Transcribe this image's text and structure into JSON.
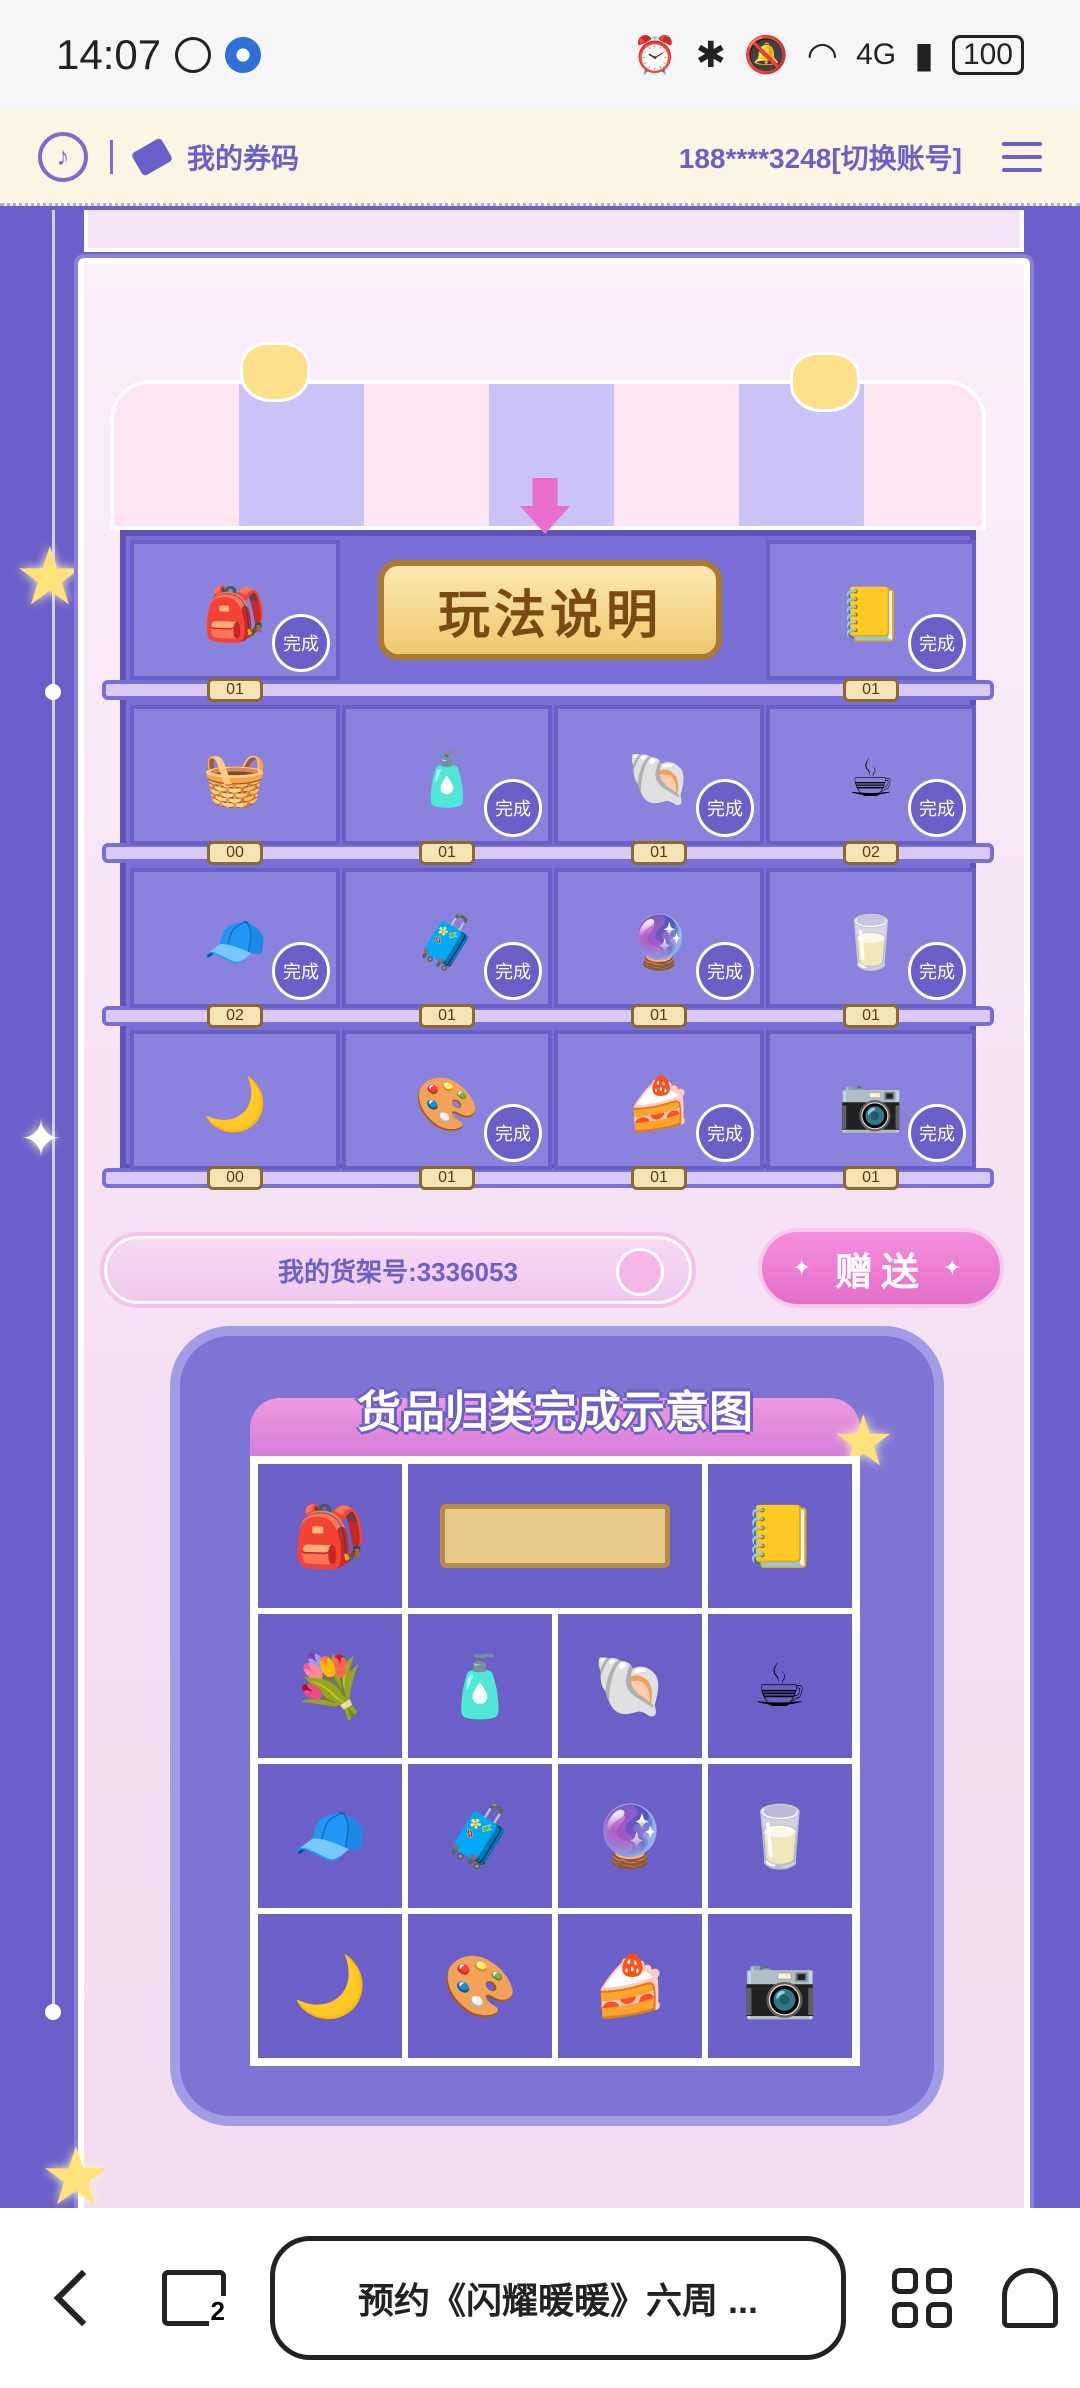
{
  "status_bar": {
    "time": "14:07",
    "network": "4G",
    "battery": "100"
  },
  "site_header": {
    "coupon_label": "我的券码",
    "account_text": "188****3248[切换账号]"
  },
  "shelf": {
    "howto_label": "玩法说明",
    "done_label": "完成",
    "rows": [
      [
        {
          "icon": "backpack-icon",
          "glyph": "🎒",
          "count": "01",
          "done": true
        },
        {
          "icon": "howto",
          "glyph": "",
          "count": "",
          "done": false
        },
        {
          "icon": "photo-album-icon",
          "glyph": "📒",
          "count": "01",
          "done": true
        }
      ],
      [
        {
          "icon": "basket-icon",
          "glyph": "🧺",
          "count": "00",
          "done": false
        },
        {
          "icon": "perfume-icon",
          "glyph": "🧴",
          "count": "01",
          "done": true
        },
        {
          "icon": "shell-icon",
          "glyph": "🐚",
          "count": "01",
          "done": true
        },
        {
          "icon": "bunny-cup-icon",
          "glyph": "☕",
          "count": "02",
          "done": true
        }
      ],
      [
        {
          "icon": "cat-hat-icon",
          "glyph": "🧢",
          "count": "02",
          "done": true
        },
        {
          "icon": "suitcase-icon",
          "glyph": "🧳",
          "count": "01",
          "done": true
        },
        {
          "icon": "crystal-ball-icon",
          "glyph": "🔮",
          "count": "01",
          "done": true
        },
        {
          "icon": "milk-box-icon",
          "glyph": "🥛",
          "count": "01",
          "done": true
        }
      ],
      [
        {
          "icon": "moon-pillow-icon",
          "glyph": "🌙",
          "count": "00",
          "done": false
        },
        {
          "icon": "palette-icon",
          "glyph": "🎨",
          "count": "01",
          "done": true
        },
        {
          "icon": "cake-icon",
          "glyph": "🍰",
          "count": "01",
          "done": true
        },
        {
          "icon": "camera-icon",
          "glyph": "📷",
          "count": "01",
          "done": true
        }
      ]
    ]
  },
  "shelf_number_text": "我的货架号:3336053",
  "gift_label": "赠送",
  "sample": {
    "title": "货品归类完成示意图",
    "items": [
      {
        "icon": "backpack-icon",
        "glyph": "🎒"
      },
      {
        "icon": "plaque-icon",
        "glyph": ""
      },
      {
        "icon": "photo-album-icon",
        "glyph": "📒"
      },
      {
        "icon": "flower-basket-icon",
        "glyph": "💐"
      },
      {
        "icon": "perfume-icon",
        "glyph": "🧴"
      },
      {
        "icon": "shell-icon",
        "glyph": "🐚"
      },
      {
        "icon": "bunny-cup-icon",
        "glyph": "☕"
      },
      {
        "icon": "cat-hat-icon",
        "glyph": "🧢"
      },
      {
        "icon": "suitcase-icon",
        "glyph": "🧳"
      },
      {
        "icon": "crystal-ball-icon",
        "glyph": "🔮"
      },
      {
        "icon": "milk-box-icon",
        "glyph": "🥛"
      },
      {
        "icon": "moon-pillow-icon",
        "glyph": "🌙"
      },
      {
        "icon": "palette-icon",
        "glyph": "🎨"
      },
      {
        "icon": "cake-icon",
        "glyph": "🍰"
      },
      {
        "icon": "camera-icon",
        "glyph": "📷"
      }
    ]
  },
  "bottom_nav": {
    "tab_count": "2",
    "page_title": "预约《闪耀暖暖》六周 ..."
  },
  "colors": {
    "primary": "#6b5fc9",
    "accent_pink": "#e46fc9",
    "header_bg": "#fbf6e4"
  }
}
